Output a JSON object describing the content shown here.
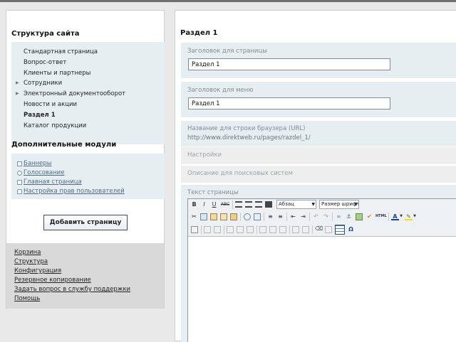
{
  "sidebar": {
    "title": "Структура сайта",
    "tree": [
      {
        "label": "Стандартная страница",
        "arrow": false,
        "active": false
      },
      {
        "label": "Вопрос-ответ",
        "arrow": false,
        "active": false
      },
      {
        "label": "Клиенты и партнеры",
        "arrow": false,
        "active": false
      },
      {
        "label": "Сотрудники",
        "arrow": true,
        "active": false
      },
      {
        "label": "Электронный документооборот",
        "arrow": true,
        "active": false
      },
      {
        "label": "Новости и акции",
        "arrow": false,
        "active": false
      },
      {
        "label": "Раздел 1",
        "arrow": false,
        "active": true
      },
      {
        "label": "Каталог продукции",
        "arrow": false,
        "active": false
      }
    ],
    "modules_title": "Дополнительные модули",
    "modules": [
      {
        "label": "Баннеры",
        "icon": "banner-icon"
      },
      {
        "label": "Голосование",
        "icon": "poll-icon"
      },
      {
        "label": "Главная страница",
        "icon": "home-icon"
      },
      {
        "label": "Настройка прав пользователей",
        "icon": "lock-icon"
      }
    ],
    "add_button": "Добавить страницу",
    "bottom_links": [
      "Корзина",
      "Структура",
      "Конфигурация",
      "Резервное копирование",
      "Задать вопрос в службу поддержки",
      "Помощь"
    ]
  },
  "main": {
    "section_title": "Раздел 1",
    "page_title_label": "Заголовок для страницы",
    "page_title_value": "Раздел 1",
    "menu_title_label": "Заголовок для меню",
    "menu_title_value": "Раздел 1",
    "url_label": "Название для строки браузера (URL)",
    "url_value": "http://www.direktweb.ru/pages/razdel_1/",
    "settings_label": "Настройки",
    "seo_label": "Описание для поисковых систем",
    "text_label": "Текст страницы",
    "editor": {
      "format_select": "Абзац",
      "size_select": "Размер шрифт",
      "bold": "B",
      "italic": "I",
      "underline": "U",
      "strike": "ABC"
    }
  },
  "colors": {
    "panel_bg": "#e6eef1",
    "link": "#4c6c84",
    "label_gray": "#7f8c94"
  }
}
